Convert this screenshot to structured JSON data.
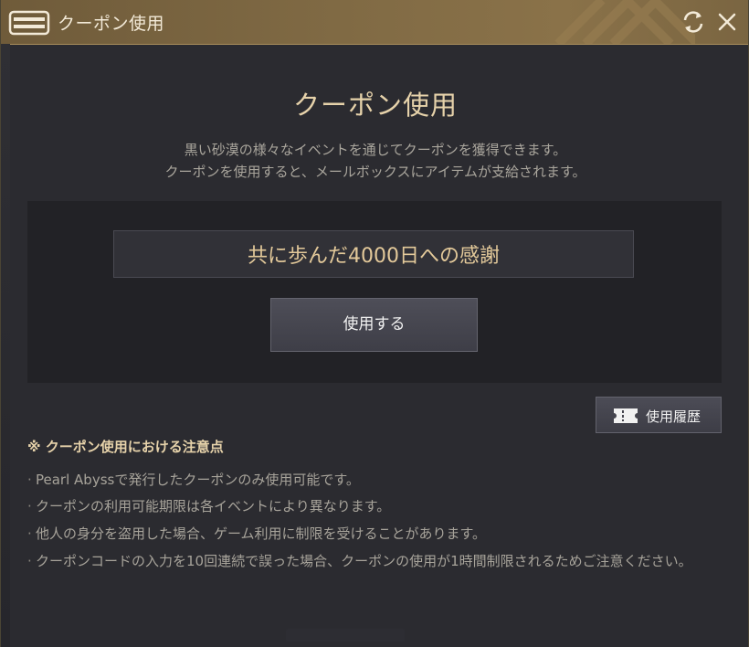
{
  "window": {
    "title": "クーポン使用",
    "icons": {
      "title": "coupon-card-icon",
      "refresh": "refresh-icon",
      "close": "close-icon"
    }
  },
  "main": {
    "heading": "クーポン使用",
    "description_line1": "黒い砂漠の様々なイベントを通じてクーポンを獲得できます。",
    "description_line2": "クーポンを使用すると、メールボックスにアイテムが支給されます。"
  },
  "coupon": {
    "input_value": "共に歩んだ4000日への感謝",
    "use_button_label": "使用する"
  },
  "history": {
    "button_label": "使用履歴",
    "icon": "ticket-icon"
  },
  "notes": {
    "title": "※ クーポン使用における注意点",
    "bullet": "·",
    "items": [
      "Pearl Abyssで発行したクーポンのみ使用可能です。",
      "クーポンの利用可能期限は各イベントにより異なります。",
      "他人の身分を盗用した場合、ゲーム利用に制限を受けることがあります。",
      "クーポンコードの入力を10回連続で誤った場合、クーポンの使用が1時間制限されるためご注意ください。"
    ]
  },
  "colors": {
    "title_bar": "#806a44",
    "accent_gold": "#e6d2aa",
    "background": "#2b2b30",
    "panel": "#222226"
  }
}
